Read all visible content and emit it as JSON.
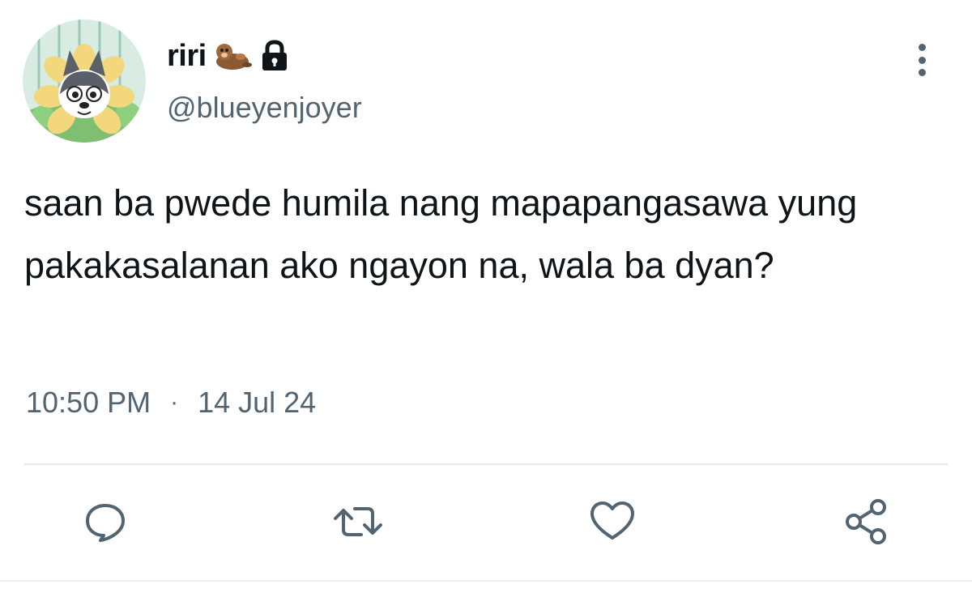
{
  "author": {
    "display_name": "riri",
    "handle": "@blueyenjoyer",
    "emoji_icon": "otter-icon",
    "protected_icon": "lock-icon"
  },
  "tweet": {
    "text": "saan ba pwede humila nang mapapangasawa yung pakakasalanan ako ngayon na, wala ba dyan?",
    "time": "10:50 PM",
    "separator": "·",
    "date": "14 Jul 24"
  },
  "actions": {
    "reply_icon": "reply-icon",
    "retweet_icon": "retweet-icon",
    "like_icon": "heart-icon",
    "share_icon": "share-icon",
    "more_icon": "more-vertical-icon"
  },
  "colors": {
    "text": "#0f1419",
    "secondary": "#536471",
    "divider": "#e6e9eb"
  }
}
